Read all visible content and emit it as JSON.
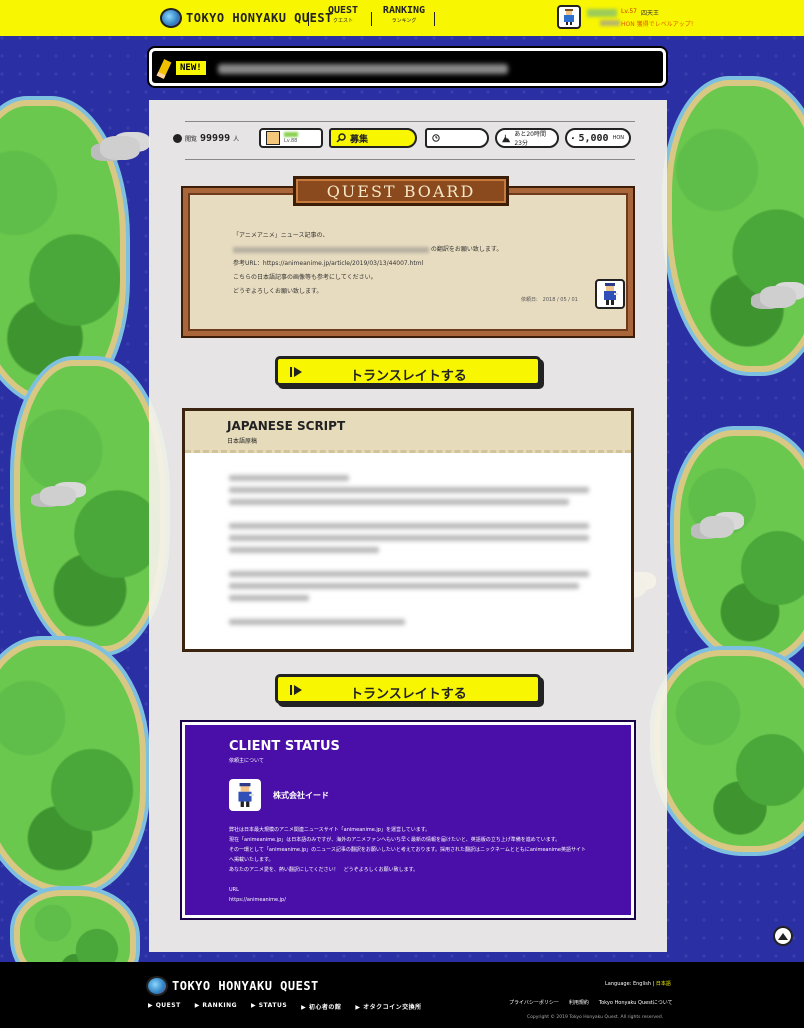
{
  "header": {
    "logo_text": "TOKYO HONYAKU QUEST",
    "nav": [
      {
        "label": "QUEST",
        "sub": "クエスト"
      },
      {
        "label": "RANKING",
        "sub": "ランキング"
      }
    ],
    "user": {
      "level": "Lv.57",
      "title": "四天王",
      "next_text": "HON 獲得でレベルアップ！"
    }
  },
  "news": {
    "badge": "NEW!"
  },
  "status": {
    "views_label": "閲覧",
    "views_count": "99999",
    "views_unit": "人",
    "level_text": "Lv.88",
    "recruit_label": "募集",
    "time_text": "あと20時間23分",
    "reward_amount": "5,000",
    "reward_unit": "HON"
  },
  "board": {
    "title": "QUEST BOARD",
    "line1": "「アニメアニメ」ニュース記事の、",
    "line2_suffix": "の翻訳をお願い致します。",
    "line3": "参考URL：https://animeanime.jp/article/2019/03/13/44007.html",
    "line4": "こちらの日本語記事の画像等も参考にしてください。",
    "line5": "どうぞよろしくお願い致します。",
    "date": "依頼日:　2018 / 05 / 01"
  },
  "translate_button": {
    "label": "トランスレイトする"
  },
  "script": {
    "title": "JAPANESE SCRIPT",
    "subtitle": "日本語原稿"
  },
  "client": {
    "title": "CLIENT STATUS",
    "subtitle": "依頼主について",
    "name": "株式会社イード",
    "description": [
      "弊社は日本最大規模のアニメ関連ニュースサイト「animeanime.jp」を運営しています。",
      "現在「animeanime.jp」は日本語のみですが、海外のアニメファンへもいち早く最新の情報を届けたいと、英語版の立ち上げ準備を進めています。",
      "その一環として「animeanime.jp」のニュース記事の翻訳をお願いしたいと考えております。採用された翻訳はニックネームとともにanimeanime英語サイト",
      "へ掲載いたします。",
      "あなたのアニメ愛を、熱い翻訳にしてください！　どうぞよろしくお願い致します。"
    ],
    "url_label": "URL",
    "url": "https://animeanime.jp/"
  },
  "footer": {
    "logo_text": "TOKYO HONYAKU QUEST",
    "nav": [
      "▶ QUEST",
      "▶ RANKING",
      "▶ STATUS",
      "▶ 初心者の館",
      "▶ オタクコイン交換所"
    ],
    "language_label": "Language: English | ",
    "language_active": "日本語",
    "links": [
      "プライバシーポリシー",
      "利用規約",
      "Tokyo Honyaku Questについて"
    ],
    "copyright": "Copyright © 2019 Tokyo Honyaku Quest. All rights reserved."
  },
  "colors": {
    "accent_yellow": "#f8f600",
    "client_purple": "#4a0fa8",
    "board_brown": "#8b4a1e"
  }
}
